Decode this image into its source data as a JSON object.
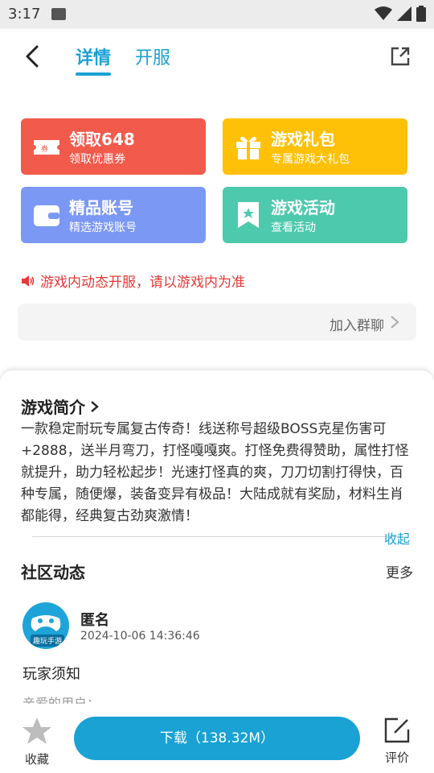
{
  "statusbar": {
    "time": "3:17"
  },
  "header": {
    "tabs": [
      "详情",
      "开服"
    ]
  },
  "cards": [
    {
      "title": "领取648",
      "subtitle": "领取优惠券",
      "icon": "coupon-icon",
      "color": "#f25a4c"
    },
    {
      "title": "游戏礼包",
      "subtitle": "专属游戏大礼包",
      "icon": "gift-icon",
      "color": "#ffc107"
    },
    {
      "title": "精品账号",
      "subtitle": "精选游戏账号",
      "icon": "wallet-icon",
      "color": "#7b98f5"
    },
    {
      "title": "游戏活动",
      "subtitle": "查看活动",
      "icon": "bookmark-star-icon",
      "color": "#4dc9ad"
    }
  ],
  "notice": "游戏内动态开服，请以游戏内为准",
  "group_chat": "加入群聊",
  "intro": {
    "title": "游戏简介",
    "text": "一款稳定耐玩专属复古传奇！线送称号超级BOSS克星伤害可+2888，送半月弯刀，打怪嘎嘎爽。打怪免费得赞助，属性打怪就提升，助力轻松起步！光速打怪真的爽，刀刀切割打得快，百种专属，随便爆，装备变异有极品！大陆成就有奖励，材料生肖都能得，经典复古劲爽激情！",
    "collapse": "收起"
  },
  "community": {
    "title": "社区动态",
    "more": "更多",
    "post": {
      "avatar_label": "趣玩手游",
      "user": "匿名",
      "time": "2024-10-06 14:36:46",
      "title": "玩家须知",
      "preview": "亲爱的用户："
    }
  },
  "bottom": {
    "favorite": "收藏",
    "download": "下载（138.32M）",
    "rate": "评价"
  },
  "colors": {
    "accent": "#1aa2d4",
    "notice": "#e53935"
  }
}
